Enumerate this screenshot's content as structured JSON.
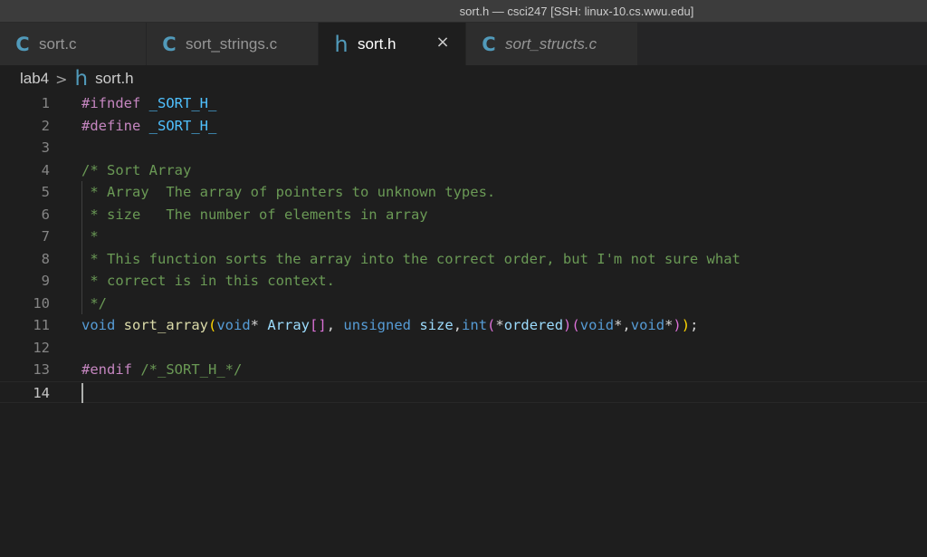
{
  "window": {
    "title": "sort.h — csci247 [SSH: linux-10.cs.wwu.edu]"
  },
  "tabs": [
    {
      "icon": "c-file-icon",
      "glyph": "C",
      "label": "sort.c",
      "active": false,
      "italic": false
    },
    {
      "icon": "c-file-icon",
      "glyph": "C",
      "label": "sort_strings.c",
      "active": false,
      "italic": false
    },
    {
      "icon": "h-file-icon",
      "glyph": "h",
      "label": "sort.h",
      "active": true,
      "italic": false,
      "close": "×"
    },
    {
      "icon": "c-file-icon",
      "glyph": "C",
      "label": "sort_structs.c",
      "active": false,
      "italic": true
    }
  ],
  "breadcrumb": {
    "folder": "lab4",
    "separator": ">",
    "file_icon": "h",
    "file": "sort.h"
  },
  "colors": {
    "editor_bg": "#1e1e1e",
    "tab_inactive": "#2d2d2d",
    "titlebar": "#3c3c3c",
    "comment": "#6a9955",
    "keyword": "#569cd6",
    "preprocessor": "#c586c0",
    "function": "#dcdcaa"
  },
  "editor": {
    "current_line": 14,
    "lines": [
      {
        "n": "1",
        "t": [
          [
            "pp",
            "#ifndef"
          ],
          [
            "pl",
            " "
          ],
          [
            "mac",
            "_SORT_H_"
          ]
        ]
      },
      {
        "n": "2",
        "t": [
          [
            "pp",
            "#define"
          ],
          [
            "pl",
            " "
          ],
          [
            "mac",
            "_SORT_H_"
          ]
        ]
      },
      {
        "n": "3",
        "t": []
      },
      {
        "n": "4",
        "t": [
          [
            "cm",
            "/* Sort Array"
          ]
        ]
      },
      {
        "n": "5",
        "t": [
          [
            "cm",
            " * Array  The array of pointers to unknown types."
          ]
        ]
      },
      {
        "n": "6",
        "t": [
          [
            "cm",
            " * size   The number of elements in array"
          ]
        ]
      },
      {
        "n": "7",
        "t": [
          [
            "cm",
            " *"
          ]
        ]
      },
      {
        "n": "8",
        "t": [
          [
            "cm",
            " * This function sorts the array into the correct order, but I'm not sure what"
          ]
        ]
      },
      {
        "n": "9",
        "t": [
          [
            "cm",
            " * correct is in this context."
          ]
        ]
      },
      {
        "n": "10",
        "t": [
          [
            "cm",
            " */"
          ]
        ]
      },
      {
        "n": "11",
        "t": [
          [
            "kw",
            "void"
          ],
          [
            "pl",
            " "
          ],
          [
            "fn",
            "sort_array"
          ],
          [
            "b1",
            "("
          ],
          [
            "kw",
            "void"
          ],
          [
            "pl",
            "* "
          ],
          [
            "var",
            "Array"
          ],
          [
            "b2",
            "[]"
          ],
          [
            "pl",
            ", "
          ],
          [
            "kw",
            "unsigned"
          ],
          [
            "pl",
            " "
          ],
          [
            "var",
            "size"
          ],
          [
            "pl",
            ","
          ],
          [
            "kw",
            "int"
          ],
          [
            "b2",
            "("
          ],
          [
            "pl",
            "*"
          ],
          [
            "var",
            "ordered"
          ],
          [
            "b2",
            ")"
          ],
          [
            "b2",
            "("
          ],
          [
            "kw",
            "void"
          ],
          [
            "pl",
            "*,"
          ],
          [
            "kw",
            "void"
          ],
          [
            "pl",
            "*"
          ],
          [
            "b2",
            ")"
          ],
          [
            "b1",
            ")"
          ],
          [
            "pl",
            ";"
          ]
        ]
      },
      {
        "n": "12",
        "t": []
      },
      {
        "n": "13",
        "t": [
          [
            "pp",
            "#endif"
          ],
          [
            "pl",
            " "
          ],
          [
            "cm",
            "/*_SORT_H_*/"
          ]
        ]
      },
      {
        "n": "14",
        "t": []
      }
    ]
  }
}
